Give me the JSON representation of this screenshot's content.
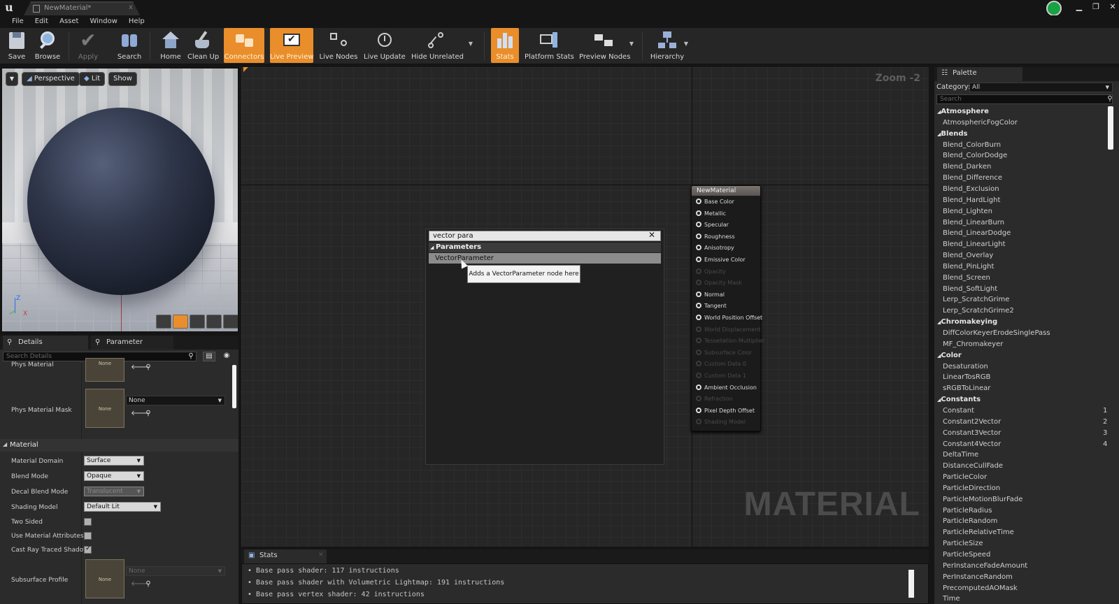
{
  "window": {
    "tab_title": "NewMaterial*",
    "tab_close": "x"
  },
  "menu": [
    "File",
    "Edit",
    "Asset",
    "Window",
    "Help"
  ],
  "toolbar": {
    "save": "Save",
    "browse": "Browse",
    "apply": "Apply",
    "search": "Search",
    "home": "Home",
    "cleanup": "Clean Up",
    "connectors": "Connectors",
    "live_preview": "Live Preview",
    "live_nodes": "Live Nodes",
    "live_update": "Live Update",
    "hide_unrelated": "Hide Unrelated",
    "stats": "Stats",
    "platform_stats": "Platform Stats",
    "preview_nodes": "Preview Nodes",
    "hierarchy": "Hierarchy"
  },
  "viewport": {
    "perspective": "Perspective",
    "lit": "Lit",
    "show": "Show",
    "axis_z": "Z",
    "axis_x": "X"
  },
  "details": {
    "tab_details": "Details",
    "tab_param_defaults": "Parameter Defaults",
    "search_placeholder": "Search Details",
    "phys_material": "Phys Material",
    "phys_material_mask": "Phys Material Mask",
    "none": "None",
    "section_material": "Material",
    "material_domain": "Material Domain",
    "material_domain_value": "Surface",
    "blend_mode": "Blend Mode",
    "blend_mode_value": "Opaque",
    "decal_blend_mode": "Decal Blend Mode",
    "decal_blend_mode_value": "Translucent",
    "shading_model": "Shading Model",
    "shading_model_value": "Default Lit",
    "two_sided": "Two Sided",
    "use_material_attributes": "Use Material Attributes",
    "cast_ray_traced_shadows": "Cast Ray Traced Shadov",
    "subsurface_profile": "Subsurface Profile"
  },
  "graph": {
    "zoom": "Zoom -2",
    "watermark": "MATERIAL",
    "node_title": "NewMaterial",
    "pins": [
      {
        "label": "Base Color",
        "enabled": true
      },
      {
        "label": "Metallic",
        "enabled": true
      },
      {
        "label": "Specular",
        "enabled": true
      },
      {
        "label": "Roughness",
        "enabled": true
      },
      {
        "label": "Anisotropy",
        "enabled": true
      },
      {
        "label": "Emissive Color",
        "enabled": true
      },
      {
        "label": "Opacity",
        "enabled": false
      },
      {
        "label": "Opacity Mask",
        "enabled": false
      },
      {
        "label": "Normal",
        "enabled": true
      },
      {
        "label": "Tangent",
        "enabled": true
      },
      {
        "label": "World Position Offset",
        "enabled": true
      },
      {
        "label": "World Displacement",
        "enabled": false
      },
      {
        "label": "Tessellation Multiplier",
        "enabled": false
      },
      {
        "label": "Subsurface Color",
        "enabled": false
      },
      {
        "label": "Custom Data 0",
        "enabled": false
      },
      {
        "label": "Custom Data 1",
        "enabled": false
      },
      {
        "label": "Ambient Occlusion",
        "enabled": true
      },
      {
        "label": "Refraction",
        "enabled": false
      },
      {
        "label": "Pixel Depth Offset",
        "enabled": true
      },
      {
        "label": "Shading Model",
        "enabled": false
      }
    ]
  },
  "context_menu": {
    "search_value": "vector para",
    "category": "Parameters",
    "item": "VectorParameter",
    "tooltip": "Adds a VectorParameter node here"
  },
  "stats": {
    "tab": "Stats",
    "lines": [
      "Base pass shader: 117 instructions",
      "Base pass shader with Volumetric Lightmap: 191 instructions",
      "Base pass vertex shader: 42 instructions"
    ]
  },
  "palette": {
    "tab": "Palette",
    "category_label": "Category:",
    "category_value": "All",
    "search_placeholder": "Search",
    "groups": [
      {
        "name": "Atmosphere",
        "items": [
          {
            "label": "AtmosphericFogColor"
          }
        ]
      },
      {
        "name": "Blends",
        "items": [
          {
            "label": "Blend_ColorBurn"
          },
          {
            "label": "Blend_ColorDodge"
          },
          {
            "label": "Blend_Darken"
          },
          {
            "label": "Blend_Difference"
          },
          {
            "label": "Blend_Exclusion"
          },
          {
            "label": "Blend_HardLight"
          },
          {
            "label": "Blend_Lighten"
          },
          {
            "label": "Blend_LinearBurn"
          },
          {
            "label": "Blend_LinearDodge"
          },
          {
            "label": "Blend_LinearLight"
          },
          {
            "label": "Blend_Overlay"
          },
          {
            "label": "Blend_PinLight"
          },
          {
            "label": "Blend_Screen"
          },
          {
            "label": "Blend_SoftLight"
          },
          {
            "label": "Lerp_ScratchGrime"
          },
          {
            "label": "Lerp_ScratchGrime2"
          }
        ]
      },
      {
        "name": "Chromakeying",
        "items": [
          {
            "label": "DiffColorKeyerErodeSinglePass"
          },
          {
            "label": "MF_Chromakeyer"
          }
        ]
      },
      {
        "name": "Color",
        "items": [
          {
            "label": "Desaturation"
          },
          {
            "label": "LinearTosRGB"
          },
          {
            "label": "sRGBToLinear"
          }
        ]
      },
      {
        "name": "Constants",
        "items": [
          {
            "label": "Constant",
            "hotkey": "1"
          },
          {
            "label": "Constant2Vector",
            "hotkey": "2"
          },
          {
            "label": "Constant3Vector",
            "hotkey": "3"
          },
          {
            "label": "Constant4Vector",
            "hotkey": "4"
          },
          {
            "label": "DeltaTime"
          },
          {
            "label": "DistanceCullFade"
          },
          {
            "label": "ParticleColor"
          },
          {
            "label": "ParticleDirection"
          },
          {
            "label": "ParticleMotionBlurFade"
          },
          {
            "label": "ParticleRadius"
          },
          {
            "label": "ParticleRandom"
          },
          {
            "label": "ParticleRelativeTime"
          },
          {
            "label": "ParticleSize"
          },
          {
            "label": "ParticleSpeed"
          },
          {
            "label": "PerInstanceFadeAmount"
          },
          {
            "label": "PerInstanceRandom"
          },
          {
            "label": "PrecomputedAOMask"
          },
          {
            "label": "Time"
          }
        ]
      }
    ]
  }
}
